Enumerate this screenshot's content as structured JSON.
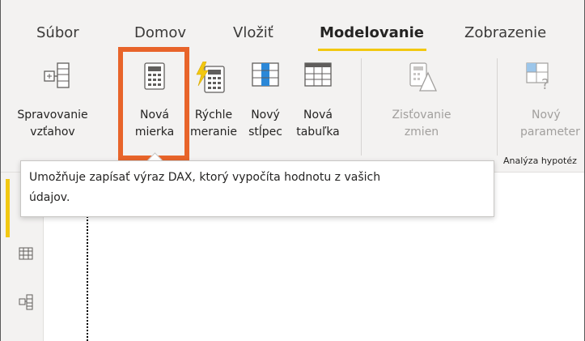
{
  "tabs": [
    {
      "label": "Súbor",
      "active": false
    },
    {
      "label": "Domov",
      "active": false
    },
    {
      "label": "Vložiť",
      "active": false
    },
    {
      "label": "Modelovanie",
      "active": true
    },
    {
      "label": "Zobrazenie",
      "active": false
    }
  ],
  "ribbon": {
    "buttons": [
      {
        "line1": "Spravovanie",
        "line2": "vzťahov",
        "icon": "manage-relationships-icon",
        "enabled": true
      },
      {
        "line1": "Nová",
        "line2": "mierka",
        "icon": "calculator-icon",
        "enabled": true
      },
      {
        "line1": "Rýchle",
        "line2": "meranie",
        "icon": "quick-measure-icon",
        "enabled": true
      },
      {
        "line1": "Nový",
        "line2": "stĺpec",
        "icon": "new-column-icon",
        "enabled": true
      },
      {
        "line1": "Nová",
        "line2": "tabuľka",
        "icon": "new-table-icon",
        "enabled": true
      },
      {
        "line1": "Zisťovanie",
        "line2": "zmien",
        "icon": "detect-changes-icon",
        "enabled": false
      },
      {
        "line1": "Nový",
        "line2": "parameter",
        "icon": "new-parameter-icon",
        "enabled": false
      }
    ],
    "group_label": "Analýza hypotéz"
  },
  "tooltip": {
    "line1": "Umožňuje zapísať výraz DAX, ktorý vypočíta hodnotu z vašich",
    "line2": "údajov."
  },
  "colors": {
    "accent_yellow": "#f2c811",
    "highlight_orange": "#e8642a",
    "ribbon_bg": "#f3f2f1"
  }
}
